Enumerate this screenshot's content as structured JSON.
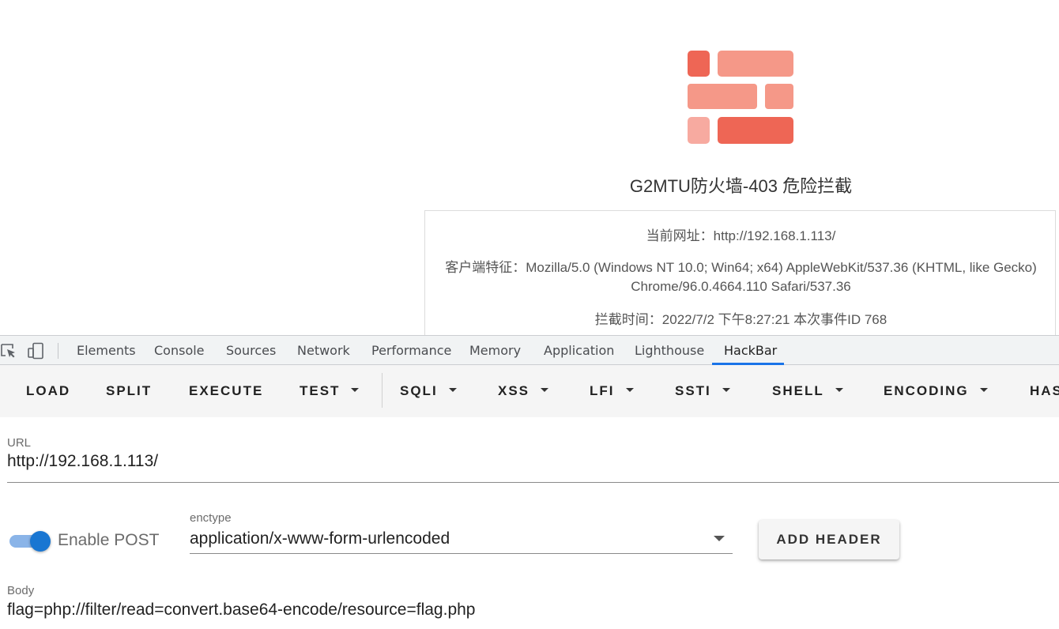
{
  "page": {
    "title": "G2MTU防火墙-403 危险拦截",
    "current_url_line": "当前网址：http://192.168.1.113/",
    "user_agent_line": "客户端特征：Mozilla/5.0 (Windows NT 10.0; Win64; x64) AppleWebKit/537.36 (KHTML, like Gecko) Chrome/96.0.4664.110 Safari/537.36",
    "intercept_line": "拦截时间：2022/7/2 下午8:27:21  本次事件ID 768",
    "logo_colors": {
      "dark": "#ee6655",
      "light": "#f59888",
      "pale": "#f7aaa0"
    }
  },
  "devtools": {
    "tabs": [
      {
        "label": "Elements"
      },
      {
        "label": "Console"
      },
      {
        "label": "Sources"
      },
      {
        "label": "Network"
      },
      {
        "label": "Performance"
      },
      {
        "label": "Memory"
      },
      {
        "label": "Application"
      },
      {
        "label": "Lighthouse"
      },
      {
        "label": "HackBar",
        "active": true
      }
    ],
    "accent_color": "#1a73e8"
  },
  "hackbar": {
    "toolbar": {
      "load": "LOAD",
      "split": "SPLIT",
      "execute": "EXECUTE",
      "test": "TEST",
      "sqli": "SQLI",
      "xss": "XSS",
      "lfi": "LFI",
      "ssti": "SSTI",
      "shell": "SHELL",
      "encoding": "ENCODING",
      "hashing": "HAS"
    },
    "url_label": "URL",
    "url_value": "http://192.168.1.113/",
    "enable_post_label": "Enable POST",
    "enable_post_checked": true,
    "enctype_label": "enctype",
    "enctype_value": "application/x-www-form-urlencoded",
    "add_header_label": "ADD HEADER",
    "body_label": "Body",
    "body_value": "flag=php://filter/read=convert.base64-encode/resource=flag.php"
  }
}
